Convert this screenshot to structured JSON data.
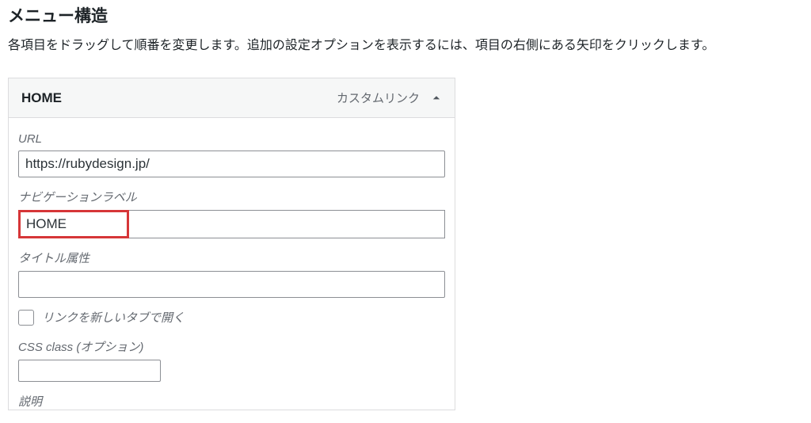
{
  "page": {
    "title": "メニュー構造",
    "description": "各項目をドラッグして順番を変更します。追加の設定オプションを表示するには、項目の右側にある矢印をクリックします。"
  },
  "menu_item": {
    "title": "HOME",
    "type_label": "カスタムリンク",
    "fields": {
      "url_label": "URL",
      "url_value": "https://rubydesign.jp/",
      "nav_label_label": "ナビゲーションラベル",
      "nav_label_value": "HOME",
      "title_attr_label": "タイトル属性",
      "title_attr_value": "",
      "open_new_tab_label": "リンクを新しいタブで開く",
      "open_new_tab_checked": false,
      "css_class_label": "CSS class (オプション)",
      "css_class_value": "",
      "description_label": "説明"
    }
  }
}
